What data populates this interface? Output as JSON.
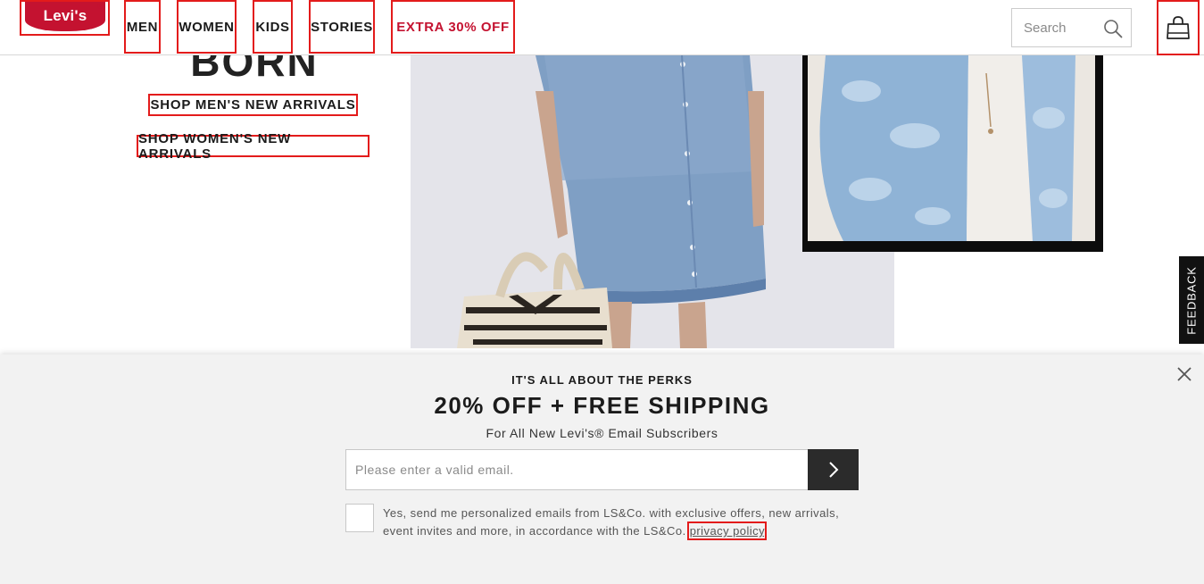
{
  "brand": {
    "logo_text": "Levi's",
    "registered_mark": "®",
    "color": "#c41230"
  },
  "nav": {
    "men": "MEN",
    "women": "WOMEN",
    "kids": "KIDS",
    "stories": "STORIES",
    "sale": "EXTRA 30% OFF"
  },
  "search": {
    "placeholder": "Search",
    "icon": "search-icon"
  },
  "cart": {
    "icon": "shopping-bag-icon"
  },
  "hero": {
    "title_partial": "BORN",
    "shop_men": "SHOP MEN'S NEW ARRIVALS",
    "shop_women": "SHOP WOMEN'S NEW ARRIVALS"
  },
  "feedback": {
    "label": "FEEDBACK"
  },
  "perks": {
    "kicker": "IT'S ALL ABOUT THE PERKS",
    "title": "20% OFF + FREE SHIPPING",
    "subtitle": "For All New Levi's® Email Subscribers",
    "email_placeholder": "Please enter a valid email.",
    "consent_text": "Yes, send me personalized emails from LS&Co. with exclusive offers, new arrivals, event invites and more, in accordance with the LS&Co. ",
    "privacy_link": "privacy policy",
    "consent_end": "."
  },
  "colors": {
    "accent_red": "#c41230",
    "highlight_box": "#e31b1b",
    "modal_bg": "#f2f2f2"
  }
}
